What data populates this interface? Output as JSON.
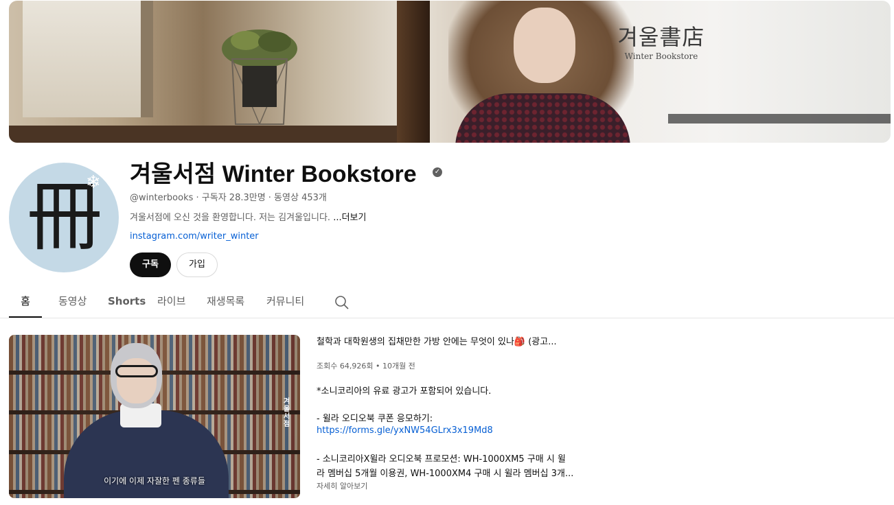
{
  "banner": {
    "title_ko": "겨울書店",
    "title_en": "Winter Bookstore"
  },
  "avatar": {
    "glyph": "冊",
    "icon": "snowflake-icon"
  },
  "channel": {
    "name": "겨울서점 Winter Bookstore",
    "verified_icon": "verified-check-icon",
    "meta": "@winterbooks · 구독자 28.3만명 · 동영상 453개",
    "description": "겨울서점에 오신 것을 환영합니다. 저는 김겨울입니다.",
    "more_label": "...더보기",
    "link": "instagram.com/writer_winter"
  },
  "buttons": {
    "subscribe": "구독",
    "join": "가입"
  },
  "tabs": [
    {
      "label": "홈",
      "active": true
    },
    {
      "label": "동영상"
    },
    {
      "label": "Shorts"
    },
    {
      "label": "라이브"
    },
    {
      "label": "재생목록"
    },
    {
      "label": "커뮤니티"
    }
  ],
  "featured_video": {
    "title": "철학과 대학원생의 집채만한 가방 안에는 무엇이 있나🎒 (광고...",
    "meta": "조회수 64,926회 • 10개월 전",
    "thumbnail_caption": "이기에 이제 자잘한 펜 종류들",
    "thumbnail_tag": "겨울서점",
    "desc_lines": [
      "*소니코리아의 유료 광고가 포함되어 있습니다.",
      "- 윌라 오디오북 쿠폰 응모하기:",
      "https://forms.gle/yxNW54GLrx3x19Md8",
      "- 소니코리아X윌라 오디오북 프로모션: WH-1000XM5 구매 시 윌",
      "라 멤버십 5개월 이용권, WH-1000XM4 구매 시 윌라 멤버십 3개..."
    ],
    "more_label": "자세히 알아보기"
  },
  "colors": {
    "link": "#065fd4",
    "secondary_text": "#606060",
    "primary_text": "#0f0f0f",
    "subscribe_bg": "#0f0f0f"
  }
}
